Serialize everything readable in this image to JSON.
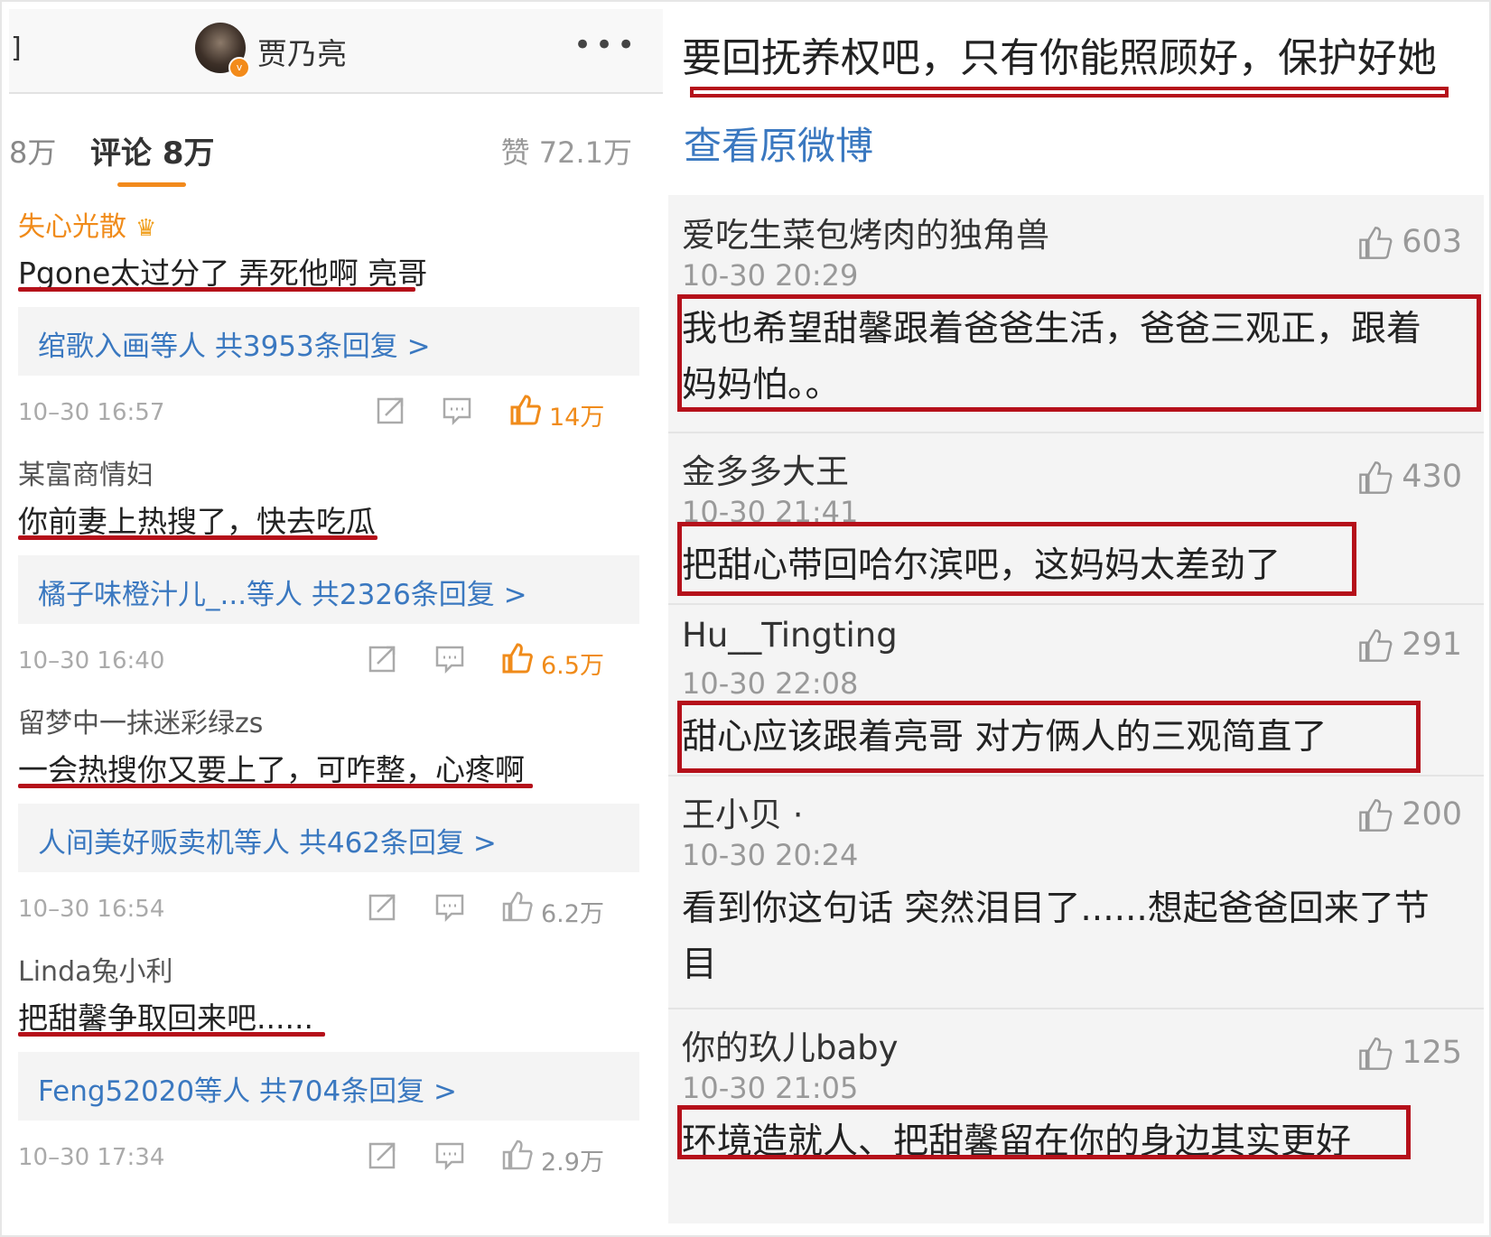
{
  "left": {
    "header": {
      "back_glyph": "]",
      "profile_name": "贾乃亮",
      "more_icon": "more-dots-icon"
    },
    "tabs": {
      "reposts": "8万",
      "comments": "评论 8万",
      "likes": "赞 72.1万"
    },
    "comments": [
      {
        "user": "失心光散",
        "text": "Pgone太过分了 弄死他啊 亮哥",
        "reply_summary": "绾歌入画等人  共3953条回复 >",
        "time": "10–30 16:57",
        "likes": "14万"
      },
      {
        "user": "某富商情妇",
        "text": "你前妻上热搜了，快去吃瓜",
        "reply_summary": "橘子味橙汁儿_...等人  共2326条回复 >",
        "time": "10–30 16:40",
        "likes": "6.5万"
      },
      {
        "user": "留梦中一抹迷彩绿zs",
        "text": "一会热搜你又要上了，可咋整，心疼啊",
        "reply_summary": "人间美好贩卖机等人  共462条回复 >",
        "time": "10–30 16:54",
        "likes": "6.2万"
      },
      {
        "user": "Linda兔小利",
        "text": "把甜馨争取回来吧......",
        "reply_summary": "Feng52020等人  共704条回复 >",
        "time": "10–30 17:34",
        "likes": "2.9万"
      }
    ],
    "colors": {
      "accent_orange": "#f08b1a",
      "link_blue": "#3a78c0",
      "highlight_red": "#b5101a"
    }
  },
  "right": {
    "original_post": "要回抚养权吧，只有你能照顾好，保护好她",
    "view_original": "查看原微博",
    "comments": [
      {
        "user": "爱吃生菜包烤肉的独角兽",
        "time": "10-30 20:29",
        "likes": "603",
        "text": "我也希望甜馨跟着爸爸生活，爸爸三观正，跟着妈妈怕。。"
      },
      {
        "user": "金多多大王",
        "time": "10-30 21:41",
        "likes": "430",
        "text": "把甜心带回哈尔滨吧，这妈妈太差劲了"
      },
      {
        "user": "Hu__Tingting",
        "time": "10-30 22:08",
        "likes": "291",
        "text": "甜心应该跟着亮哥 对方俩人的三观简直了"
      },
      {
        "user": "王小贝 ·",
        "time": "10-30 20:24",
        "likes": "200",
        "text": "看到你这句话 突然泪目了......想起爸爸回来了节目"
      },
      {
        "user": "你的玖儿baby",
        "time": "10-30 21:05",
        "likes": "125",
        "text": "环境造就人、把甜馨留在你的身边其实更好"
      }
    ]
  }
}
